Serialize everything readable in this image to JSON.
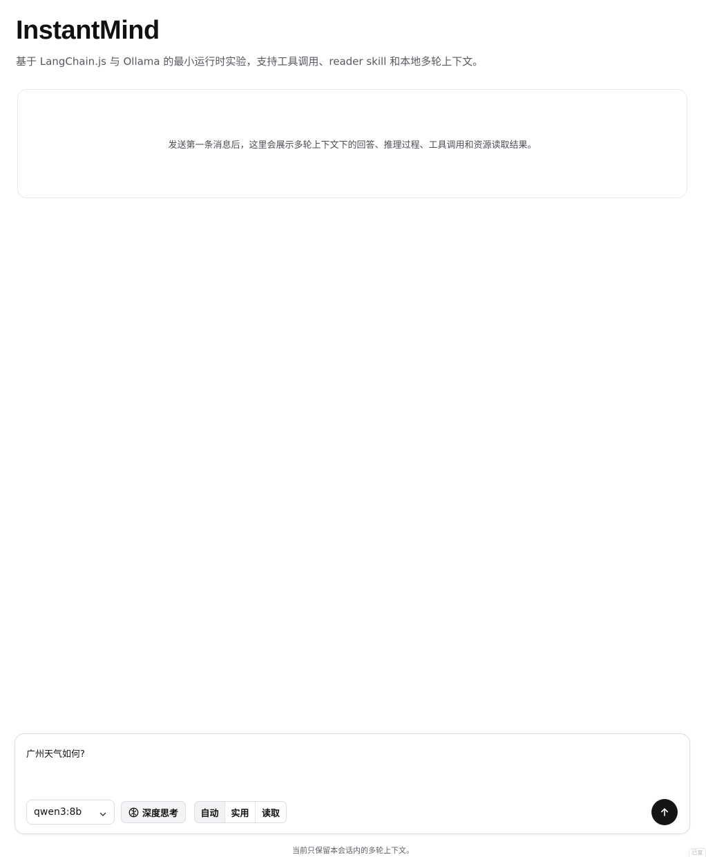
{
  "header": {
    "title": "InstantMind",
    "subtitle": "基于 LangChain.js 与 Ollama 的最小运行时实验，支持工具调用、reader skill 和本地多轮上下文。"
  },
  "conversation": {
    "empty_message": "发送第一条消息后，这里会展示多轮上下文下的回答、推理过程、工具调用和资源读取结果。"
  },
  "composer": {
    "input_value": "广州天气如何?",
    "model": {
      "selected": "qwen3:8b",
      "icon": "chevron-down-icon"
    },
    "think_toggle": {
      "label": "深度思考",
      "icon": "brain-icon",
      "enabled": true
    },
    "modes": [
      {
        "label": "自动",
        "active": true
      },
      {
        "label": "实用",
        "active": false
      },
      {
        "label": "读取",
        "active": false
      }
    ],
    "send": {
      "icon": "arrow-up-icon"
    }
  },
  "footer": {
    "note": "当前只保留本会话内的多轮上下文。",
    "corner_badge": "已复"
  },
  "colors": {
    "accent": "#151515",
    "border": "#dcdde1",
    "muted_text": "#555a60"
  }
}
